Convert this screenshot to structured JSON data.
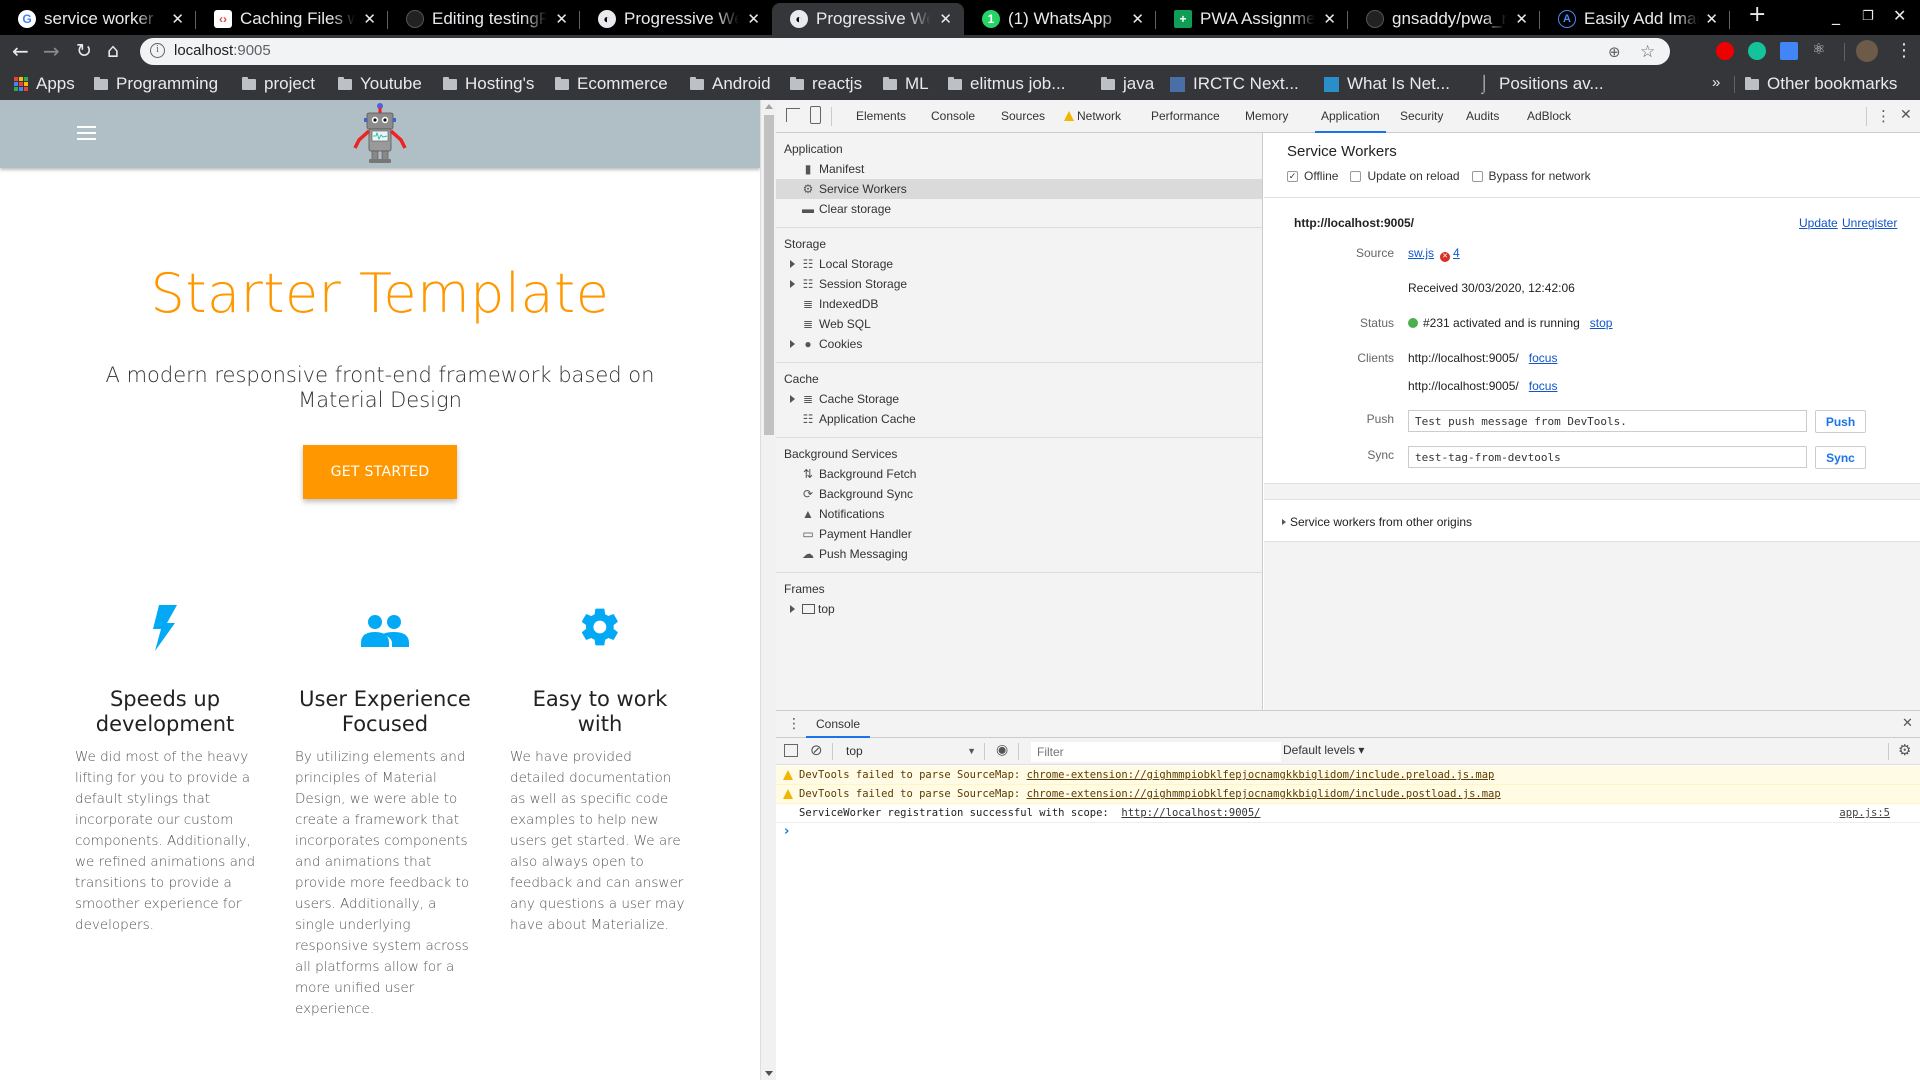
{
  "browser": {
    "tabs": [
      {
        "title": "service worker t",
        "icon": "google-icon",
        "active": false
      },
      {
        "title": "Caching Files wi",
        "icon": "web-dev-icon",
        "active": false
      },
      {
        "title": "Editing testingP",
        "icon": "github-icon",
        "active": false
      },
      {
        "title": "Progressive Wel",
        "icon": "globe-icon",
        "active": false
      },
      {
        "title": "Progressive Wel",
        "icon": "globe-icon",
        "active": true
      },
      {
        "title": "(1) WhatsApp",
        "icon": "whatsapp-icon",
        "active": false
      },
      {
        "title": "PWA Assignmen",
        "icon": "sheets-icon",
        "active": false
      },
      {
        "title": "gnsaddy/pwa_n",
        "icon": "github-icon",
        "active": false
      },
      {
        "title": "Easily Add Imag",
        "icon": "a-logo-icon",
        "active": false
      }
    ],
    "new_tab": "+",
    "url_host": "localhost",
    "url_port": ":9005",
    "bookmarks": [
      {
        "label": "Apps",
        "icon": "apps-icon"
      },
      {
        "label": "Programming",
        "icon": "folder-icon"
      },
      {
        "label": "project",
        "icon": "folder-icon"
      },
      {
        "label": "Youtube",
        "icon": "folder-icon"
      },
      {
        "label": "Hosting's",
        "icon": "folder-icon"
      },
      {
        "label": "Ecommerce",
        "icon": "folder-icon"
      },
      {
        "label": "Android",
        "icon": "folder-icon"
      },
      {
        "label": "reactjs",
        "icon": "folder-icon"
      },
      {
        "label": "ML",
        "icon": "folder-icon"
      },
      {
        "label": "elitmus job...",
        "icon": "folder-icon"
      },
      {
        "label": "java",
        "icon": "folder-icon"
      },
      {
        "label": "IRCTC Next...",
        "icon": "irctc-icon"
      },
      {
        "label": "What Is Net...",
        "icon": "cisco-icon"
      },
      {
        "label": "Positions av...",
        "icon": "hook-icon"
      }
    ],
    "bookmarks_overflow": "»",
    "other_bookmarks": "Other bookmarks"
  },
  "page": {
    "hero_title": "Starter Template",
    "hero_subtitle": "A modern responsive front-end framework based on Material Design",
    "cta_label": "GET STARTED",
    "accent_color": "#ff9800",
    "navbar_color": "#b0bec5",
    "icon_color": "#03a9f4",
    "features": [
      {
        "icon": "flash-icon",
        "title": "Speeds up development",
        "text": "We did most of the heavy lifting for you to provide a default stylings that incorporate our custom components. Additionally, we refined animations and transitions to provide a smoother experience for developers."
      },
      {
        "icon": "group-icon",
        "title": "User Experience Focused",
        "text": "By utilizing elements and principles of Material Design, we were able to create a framework that incorporates components and animations that provide more feedback to users. Additionally, a single underlying responsive system across all platforms allow for a more unified user experience."
      },
      {
        "icon": "settings-icon",
        "title": "Easy to work with",
        "text": "We have provided detailed documentation as well as specific code examples to help new users get started. We are also always open to feedback and can answer any questions a user may have about Materialize."
      }
    ]
  },
  "devtools": {
    "tabs": [
      "Elements",
      "Console",
      "Sources",
      "Network",
      "Performance",
      "Memory",
      "Application",
      "Security",
      "Audits",
      "AdBlock"
    ],
    "active_tab": "Application",
    "sidebar": {
      "sections": [
        {
          "title": "Application",
          "items": [
            {
              "label": "Manifest",
              "icon": "file-icon",
              "expandable": false
            },
            {
              "label": "Service Workers",
              "icon": "gear-icon",
              "expandable": false,
              "selected": true
            },
            {
              "label": "Clear storage",
              "icon": "trash-icon",
              "expandable": false
            }
          ]
        },
        {
          "title": "Storage",
          "items": [
            {
              "label": "Local Storage",
              "icon": "table-icon",
              "expandable": true
            },
            {
              "label": "Session Storage",
              "icon": "table-icon",
              "expandable": true
            },
            {
              "label": "IndexedDB",
              "icon": "database-icon",
              "expandable": false
            },
            {
              "label": "Web SQL",
              "icon": "database-icon",
              "expandable": false
            },
            {
              "label": "Cookies",
              "icon": "cookie-icon",
              "expandable": true
            }
          ]
        },
        {
          "title": "Cache",
          "items": [
            {
              "label": "Cache Storage",
              "icon": "database-icon",
              "expandable": true
            },
            {
              "label": "Application Cache",
              "icon": "table-icon",
              "expandable": false
            }
          ]
        },
        {
          "title": "Background Services",
          "items": [
            {
              "label": "Background Fetch",
              "icon": "up-down-arrows-icon",
              "expandable": false
            },
            {
              "label": "Background Sync",
              "icon": "sync-icon",
              "expandable": false
            },
            {
              "label": "Notifications",
              "icon": "bell-icon",
              "expandable": false
            },
            {
              "label": "Payment Handler",
              "icon": "card-icon",
              "expandable": false
            },
            {
              "label": "Push Messaging",
              "icon": "cloud-icon",
              "expandable": false
            }
          ]
        },
        {
          "title": "Frames",
          "items": [
            {
              "label": "top",
              "icon": "frame-icon",
              "expandable": true
            }
          ]
        }
      ]
    },
    "service_workers": {
      "title": "Service Workers",
      "options": [
        {
          "label": "Offline",
          "checked": true
        },
        {
          "label": "Update on reload",
          "checked": false
        },
        {
          "label": "Bypass for network",
          "checked": false
        }
      ],
      "origin": "http://localhost:9005/",
      "update_link": "Update",
      "unregister_link": "Unregister",
      "source_label": "Source",
      "source_file": "sw.js",
      "error_count": "4",
      "received": "Received 30/03/2020, 12:42:06",
      "status_label": "Status",
      "status_text": "#231 activated and is running",
      "status_action": "stop",
      "clients_label": "Clients",
      "clients": [
        {
          "url": "http://localhost:9005/",
          "action": "focus"
        },
        {
          "url": "http://localhost:9005/",
          "action": "focus"
        }
      ],
      "push_label": "Push",
      "push_value": "Test push message from DevTools.",
      "push_button": "Push",
      "sync_label": "Sync",
      "sync_value": "test-tag-from-devtools",
      "sync_button": "Sync",
      "other_origins": "Service workers from other origins"
    },
    "console": {
      "drawer_tab": "Console",
      "context": "top",
      "filter_placeholder": "Filter",
      "levels": "Default levels ▾",
      "messages": [
        {
          "type": "warning",
          "text": "DevTools failed to parse SourceMap: ",
          "link": "chrome-extension://gighmmpiobklfepjocnamgkkbiglidom/include.preload.js.map",
          "source": ""
        },
        {
          "type": "warning",
          "text": "DevTools failed to parse SourceMap: ",
          "link": "chrome-extension://gighmmpiobklfepjocnamgkkbiglidom/include.postload.js.map",
          "source": ""
        },
        {
          "type": "log",
          "text": "ServiceWorker registration successful with scope:  ",
          "link": "http://localhost:9005/",
          "source": "app.js:5"
        }
      ],
      "prompt": "›"
    }
  }
}
